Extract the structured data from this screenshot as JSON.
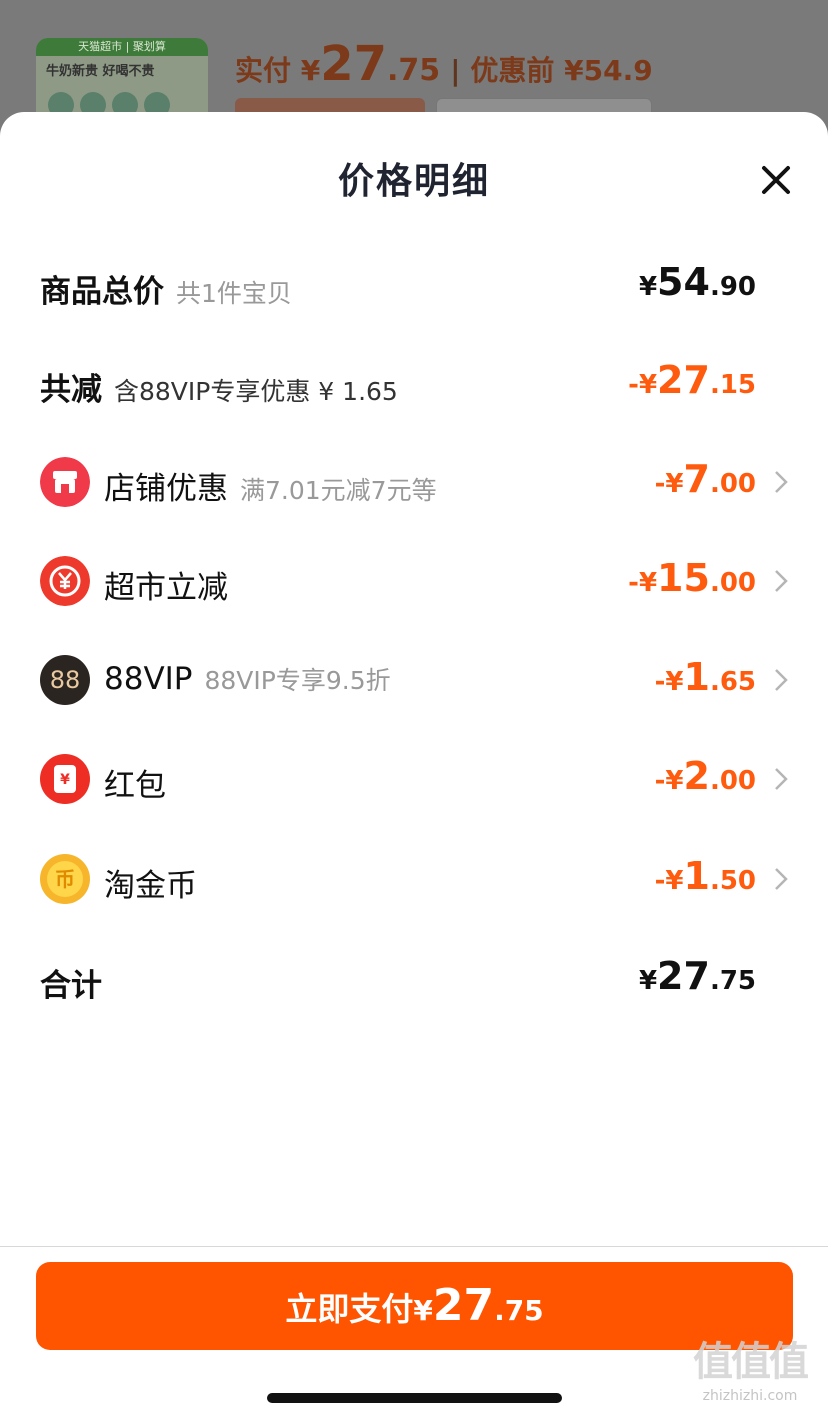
{
  "background": {
    "thumb_top": "天猫超市 | 聚划算",
    "thumb_line": "牛奶新贵 好喝不贵",
    "price_label": "实付 ¥",
    "price_int": "27",
    "price_dec": ".75",
    "orig_label": "优惠前 ¥54.9"
  },
  "sheet": {
    "title": "价格明细"
  },
  "rows": {
    "total": {
      "label": "商品总价",
      "sub": "共1件宝贝",
      "yen": "¥",
      "int": "54",
      "dec": ".90"
    },
    "reduce": {
      "label": "共减",
      "sub": "含88VIP专享优惠 ¥ 1.65",
      "yen": "-¥",
      "int": "27",
      "dec": ".15"
    },
    "shop": {
      "label": "店铺优惠",
      "sub": "满7.01元减7元等",
      "yen": "-¥",
      "int": "7",
      "dec": ".00"
    },
    "market": {
      "label": "超市立减",
      "sub": "",
      "yen": "-¥",
      "int": "15",
      "dec": ".00"
    },
    "vip": {
      "icon_text": "88",
      "label": "88VIP",
      "sub": "88VIP专享9.5折",
      "yen": "-¥",
      "int": "1",
      "dec": ".65"
    },
    "redpack": {
      "icon_text": "¥",
      "label": "红包",
      "sub": "",
      "yen": "-¥",
      "int": "2",
      "dec": ".00"
    },
    "coin": {
      "icon_text": "币",
      "label": "淘金币",
      "sub": "",
      "yen": "-¥",
      "int": "1",
      "dec": ".50"
    },
    "sum": {
      "label": "合计",
      "yen": "¥",
      "int": "27",
      "dec": ".75"
    }
  },
  "pay_button": {
    "text": "立即支付",
    "yen": "¥",
    "int": "27",
    "dec": ".75"
  },
  "watermark": {
    "big": "值值值",
    "small": "zhizhizhi.com"
  },
  "colors": {
    "accent": "#ff5500",
    "discount": "#ff5b0f",
    "shop_icon": "#f03a4a",
    "market_icon": "#ee3a2c",
    "vip_icon": "#2b2522",
    "coin_icon": "#f7b52c"
  },
  "icons": {
    "close": "close-icon",
    "shop": "shop-icon",
    "market": "supermarket-discount-icon",
    "vip": "88vip-icon",
    "redpack": "red-packet-icon",
    "coin": "taojinbi-coin-icon",
    "chevron": "chevron-right-icon"
  }
}
